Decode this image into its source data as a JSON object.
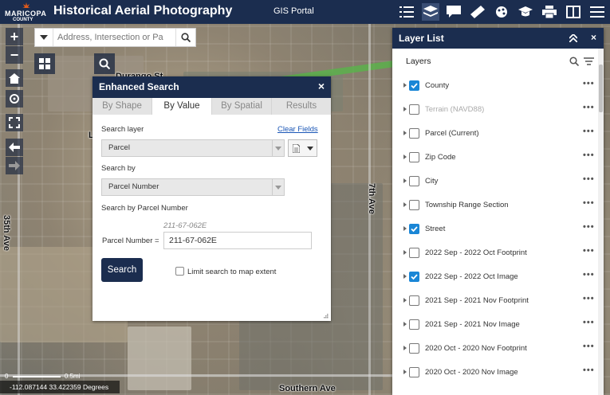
{
  "header": {
    "logo_line1": "MARICOPA",
    "logo_line2": "COUNTY",
    "title": "Historical Aerial Photography",
    "portal_label": "GIS Portal",
    "icons": [
      "list-icon",
      "layers-icon",
      "chat-icon",
      "measure-icon",
      "palette-icon",
      "education-icon",
      "print-icon",
      "compare-icon",
      "menu-icon"
    ]
  },
  "map": {
    "road_labels": {
      "top": "Durango St",
      "left": "35th Ave",
      "middle": "7th Ave",
      "bottom": "Southern Ave",
      "left_mini": "L"
    },
    "coordinates": "-112.087144 33.422359 Degrees",
    "scale": {
      "left": "0",
      "right": "0.5mi"
    }
  },
  "geocoder": {
    "placeholder": "Address, Intersection or Pa"
  },
  "enhanced_search": {
    "title": "Enhanced Search",
    "close": "×",
    "tabs": [
      "By Shape",
      "By Value",
      "By Spatial",
      "Results"
    ],
    "active_tab": "By Value",
    "search_layer_label": "Search layer",
    "clear_fields": "Clear Fields",
    "search_layer_value": "Parcel",
    "search_by_label": "Search by",
    "search_by_value": "Parcel Number",
    "search_by_heading": "Search by Parcel Number",
    "parcel_hint": "211-67-062E",
    "parcel_label": "Parcel Number =",
    "parcel_value": "211-67-062E",
    "search_button": "Search",
    "limit_label": "Limit search to map extent"
  },
  "layer_list": {
    "title": "Layer List",
    "subtitle": "Layers",
    "layers": [
      {
        "name": "County",
        "checked": true,
        "dim": false
      },
      {
        "name": "Terrain (NAVD88)",
        "checked": false,
        "dim": true
      },
      {
        "name": "Parcel (Current)",
        "checked": false,
        "dim": false
      },
      {
        "name": "Zip Code",
        "checked": false,
        "dim": false
      },
      {
        "name": "City",
        "checked": false,
        "dim": false
      },
      {
        "name": "Township Range Section",
        "checked": false,
        "dim": false
      },
      {
        "name": "Street",
        "checked": true,
        "dim": false
      },
      {
        "name": "2022 Sep - 2022 Oct Footprint",
        "checked": false,
        "dim": false
      },
      {
        "name": "2022 Sep - 2022 Oct Image",
        "checked": true,
        "dim": false
      },
      {
        "name": "2021 Sep - 2021 Nov Footprint",
        "checked": false,
        "dim": false
      },
      {
        "name": "2021 Sep - 2021 Nov Image",
        "checked": false,
        "dim": false
      },
      {
        "name": "2020 Oct - 2020 Nov Footprint",
        "checked": false,
        "dim": false
      },
      {
        "name": "2020 Oct - 2020 Nov Image",
        "checked": false,
        "dim": false
      }
    ]
  },
  "colors": {
    "header": "#1b2d4f",
    "accent": "#1a86d6"
  }
}
